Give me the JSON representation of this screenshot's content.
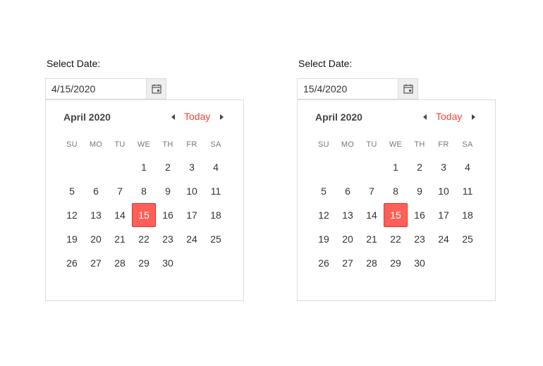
{
  "pickers": [
    {
      "label": "Select Date:",
      "value": "4/15/2020",
      "calendar": {
        "month_title": "April 2020",
        "today_label": "Today",
        "prev_icon": "triangle-left-icon",
        "next_icon": "triangle-right-icon",
        "weekdays": [
          "SU",
          "MO",
          "TU",
          "WE",
          "TH",
          "FR",
          "SA"
        ],
        "weeks": [
          [
            "",
            "",
            "",
            "1",
            "2",
            "3",
            "4"
          ],
          [
            "5",
            "6",
            "7",
            "8",
            "9",
            "10",
            "11"
          ],
          [
            "12",
            "13",
            "14",
            "15",
            "16",
            "17",
            "18"
          ],
          [
            "19",
            "20",
            "21",
            "22",
            "23",
            "24",
            "25"
          ],
          [
            "26",
            "27",
            "28",
            "29",
            "30",
            "",
            ""
          ]
        ],
        "selected_day": "15"
      }
    },
    {
      "label": "Select Date:",
      "value": "15/4/2020",
      "calendar": {
        "month_title": "April 2020",
        "today_label": "Today",
        "prev_icon": "triangle-left-icon",
        "next_icon": "triangle-right-icon",
        "weekdays": [
          "SU",
          "MO",
          "TU",
          "WE",
          "TH",
          "FR",
          "SA"
        ],
        "weeks": [
          [
            "",
            "",
            "",
            "1",
            "2",
            "3",
            "4"
          ],
          [
            "5",
            "6",
            "7",
            "8",
            "9",
            "10",
            "11"
          ],
          [
            "12",
            "13",
            "14",
            "15",
            "16",
            "17",
            "18"
          ],
          [
            "19",
            "20",
            "21",
            "22",
            "23",
            "24",
            "25"
          ],
          [
            "26",
            "27",
            "28",
            "29",
            "30",
            "",
            ""
          ]
        ],
        "selected_day": "15"
      }
    }
  ],
  "colors": {
    "accent": "#f44336",
    "selected_bg": "#ff5f57",
    "selected_border": "#d9362c",
    "button_bg": "#eeeeee",
    "border": "#dcdcdc"
  }
}
